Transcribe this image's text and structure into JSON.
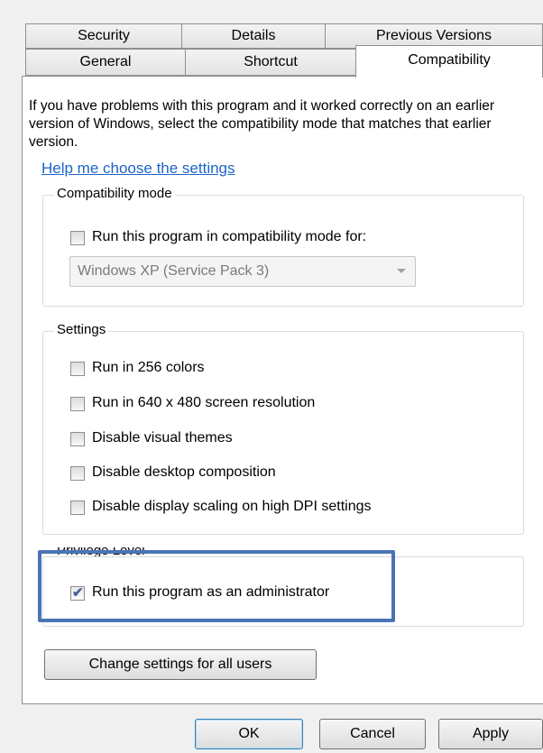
{
  "tabs": {
    "row1": [
      "Security",
      "Details",
      "Previous Versions"
    ],
    "row2": [
      "General",
      "Shortcut",
      "Compatibility"
    ]
  },
  "intro_text": "If you have problems with this program and it worked correctly on an earlier version of Windows, select the compatibility mode that matches that earlier version.",
  "help_link": "Help me choose the settings",
  "compat_mode": {
    "legend": "Compatibility mode",
    "checkbox_label": "Run this program in compatibility mode for:",
    "checked": false,
    "dropdown_value": "Windows XP (Service Pack 3)"
  },
  "settings": {
    "legend": "Settings",
    "items": [
      {
        "label": "Run in 256 colors",
        "checked": false
      },
      {
        "label": "Run in 640 x 480 screen resolution",
        "checked": false
      },
      {
        "label": "Disable visual themes",
        "checked": false
      },
      {
        "label": "Disable desktop composition",
        "checked": false
      },
      {
        "label": "Disable display scaling on high DPI settings",
        "checked": false
      }
    ]
  },
  "privilege": {
    "legend": "Privilege Level",
    "checkbox_label": "Run this program as an administrator",
    "checked": true
  },
  "change_all_button": "Change settings for all users",
  "buttons": {
    "ok": "OK",
    "cancel": "Cancel",
    "apply": "Apply"
  },
  "colors": {
    "highlight_box": "#4a74b5",
    "link": "#1c64c8"
  }
}
